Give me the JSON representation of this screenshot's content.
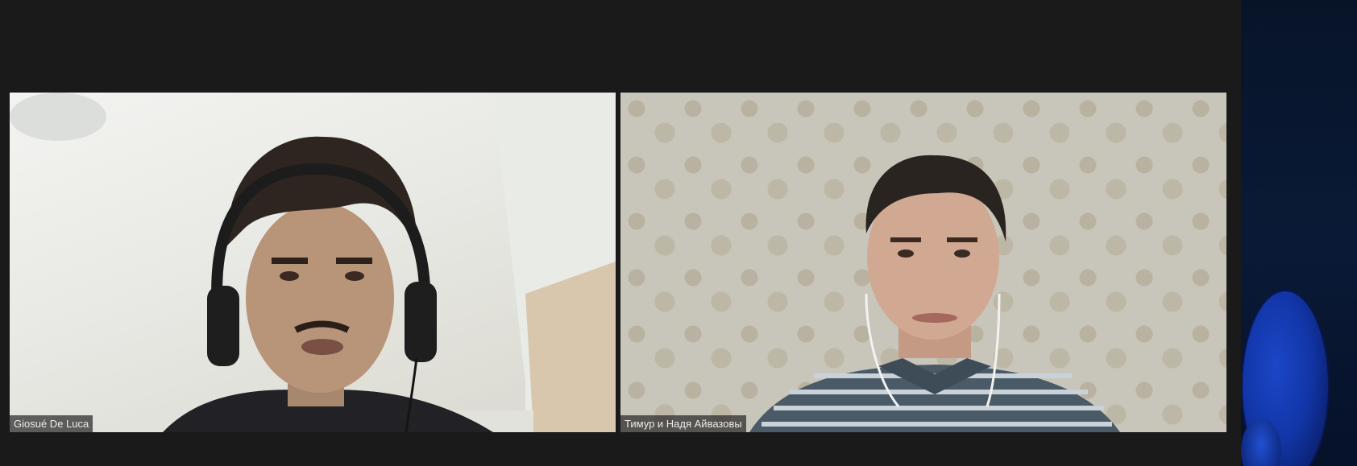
{
  "participants": [
    {
      "name": "Giosué De Luca"
    },
    {
      "name": "Тимур и Надя Айвазовы"
    }
  ],
  "colors": {
    "background": "#1a1a1a",
    "label_bg": "#282828",
    "label_text": "#ececec",
    "side_panel": "#0a1a36",
    "side_orb": "#1b46c6"
  }
}
